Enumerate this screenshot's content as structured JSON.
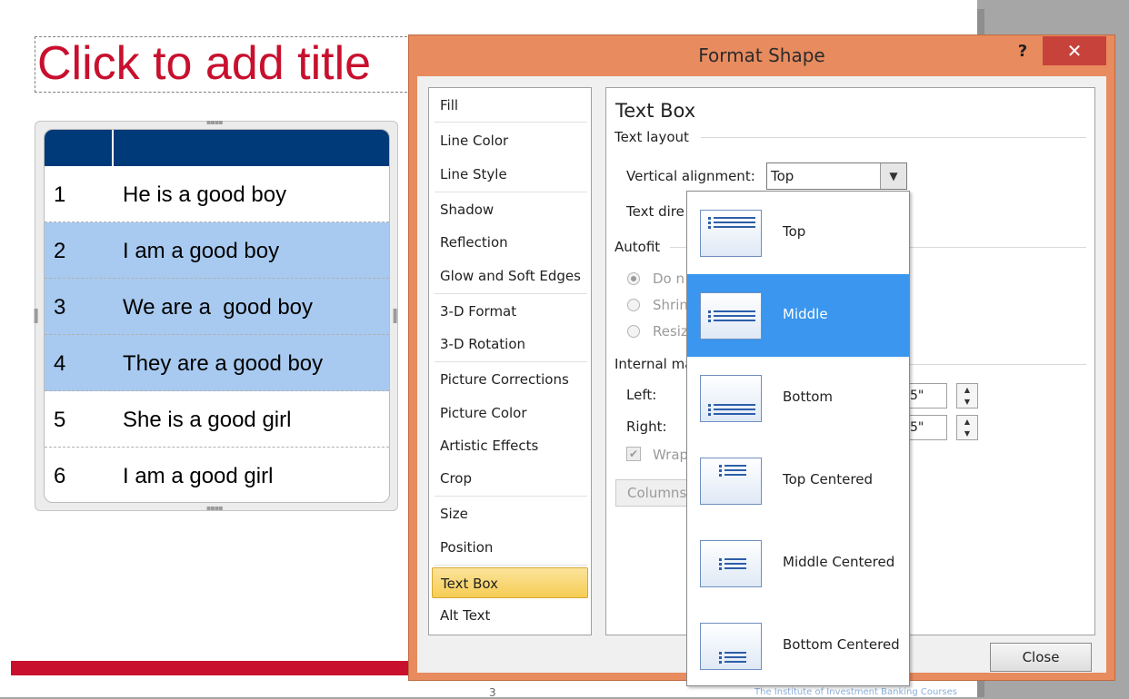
{
  "slide": {
    "title_placeholder": "Click to add title",
    "table": {
      "rows": [
        {
          "num": "1",
          "text": "He is a good boy"
        },
        {
          "num": "2",
          "text": "I am a good boy"
        },
        {
          "num": "3",
          "text": "We are a  good boy"
        },
        {
          "num": "4",
          "text": "They are a good boy"
        },
        {
          "num": "5",
          "text": "She is a good girl"
        },
        {
          "num": "6",
          "text": "I am a good girl"
        }
      ]
    },
    "slide_number": "3",
    "footer": "The Institute of Investment Banking Courses",
    "colors": {
      "title": "#c8102e",
      "header": "#003a78",
      "highlight": "#a8caf0",
      "bar": "#c8102e"
    }
  },
  "dialog": {
    "title": "Format Shape",
    "help": "?",
    "close_x": "✕",
    "nav": [
      "Fill",
      "Line Color",
      "Line Style",
      "Shadow",
      "Reflection",
      "Glow and Soft Edges",
      "3-D Format",
      "3-D Rotation",
      "Picture Corrections",
      "Picture Color",
      "Artistic Effects",
      "Crop",
      "Size",
      "Position",
      "Text Box",
      "Alt Text"
    ],
    "selected_nav": "Text Box",
    "content": {
      "heading": "Text Box",
      "text_layout": "Text layout",
      "vertical_alignment_label": "Vertical alignment:",
      "vertical_alignment_value": "Top",
      "text_direction_label": "Text dire",
      "autofit": "Autofit",
      "autofit_options": [
        "Do n",
        "Shrin",
        "Resiz"
      ],
      "internal_margin": "Internal ma",
      "left_label": "Left:",
      "right_label": "Right:",
      "left_value": "5\"",
      "right_value": "5\"",
      "wrap_label": "Wrap",
      "columns_button": "Columns"
    },
    "close_button": "Close"
  },
  "dropdown": {
    "options": [
      "Top",
      "Middle",
      "Bottom",
      "Top Centered",
      "Middle Centered",
      "Bottom Centered"
    ],
    "selected": "Middle",
    "icons": [
      "align-top-icon",
      "align-middle-icon",
      "align-bottom-icon",
      "align-top-centered-icon",
      "align-middle-centered-icon",
      "align-bottom-centered-icon"
    ]
  }
}
